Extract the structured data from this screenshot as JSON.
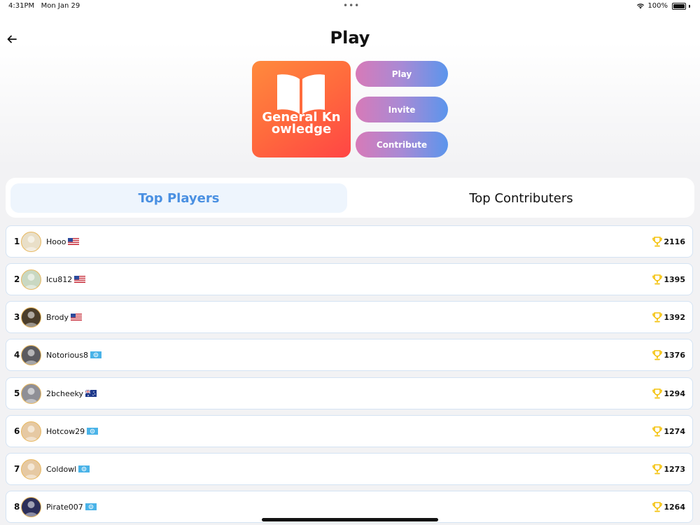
{
  "status_bar": {
    "time": "4:31PM",
    "date": "Mon Jan 29",
    "battery": "100%",
    "dots": "•••"
  },
  "header": {
    "title": "Play"
  },
  "quiz": {
    "name": "General Knowledge"
  },
  "actions": {
    "play": "Play",
    "invite": "Invite",
    "contribute": "Contribute"
  },
  "tabs": {
    "top_players": "Top Players",
    "top_contributers": "Top Contributers"
  },
  "leaderboard": [
    {
      "rank": "1",
      "name": "Hooo",
      "flag": "us",
      "score": "2116",
      "avatar_color": "#e9dfc8"
    },
    {
      "rank": "2",
      "name": "Icu812",
      "flag": "us",
      "score": "1395",
      "avatar_color": "#c9d8c2"
    },
    {
      "rank": "3",
      "name": "Brody",
      "flag": "us",
      "score": "1392",
      "avatar_color": "#4a3d2b"
    },
    {
      "rank": "4",
      "name": "Notorious8",
      "flag": "un",
      "score": "1376",
      "avatar_color": "#5b5b60"
    },
    {
      "rank": "5",
      "name": "2bcheeky",
      "flag": "au",
      "score": "1294",
      "avatar_color": "#8f8f96"
    },
    {
      "rank": "6",
      "name": "Hotcow29",
      "flag": "un",
      "score": "1274",
      "avatar_color": "#e6c9a3"
    },
    {
      "rank": "7",
      "name": "Coldowl",
      "flag": "un",
      "score": "1273",
      "avatar_color": "#e6c9a3"
    },
    {
      "rank": "8",
      "name": "Pirate007",
      "flag": "un",
      "score": "1264",
      "avatar_color": "#2c2f5a"
    }
  ]
}
